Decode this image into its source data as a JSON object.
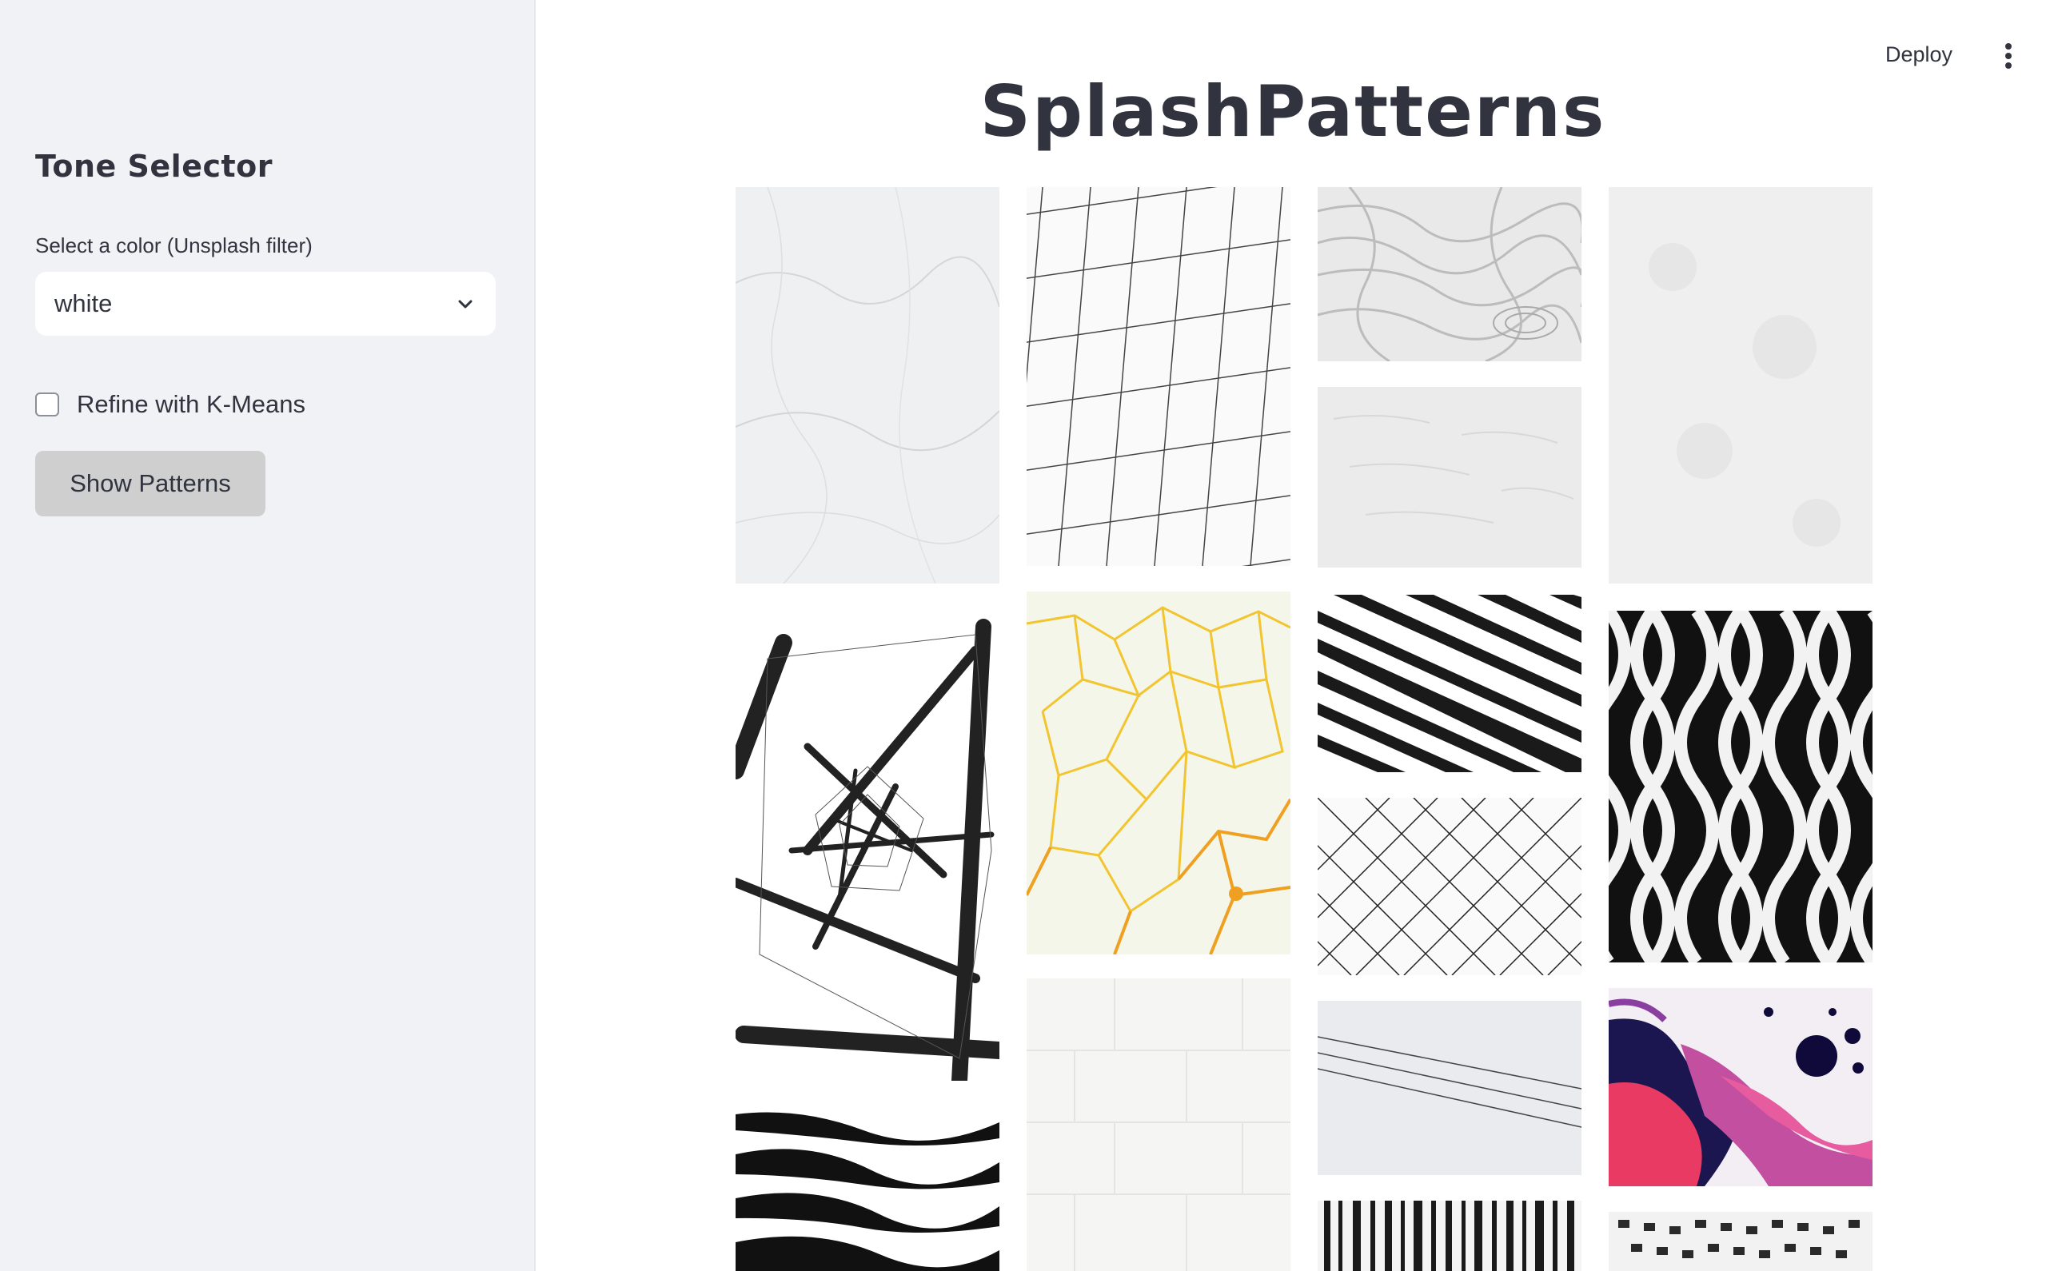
{
  "sidebar": {
    "title": "Tone Selector",
    "color_label": "Select a color (Unsplash filter)",
    "color_value": "white",
    "refine_label": "Refine with K-Means",
    "refine_checked": false,
    "button_label": "Show Patterns"
  },
  "header": {
    "deploy_label": "Deploy",
    "menu_icon": "more-vertical-icon"
  },
  "main": {
    "title": "SplashPatterns"
  },
  "gallery": {
    "columns": [
      [
        "white-marble",
        "black-poles-spiral",
        "black-white-waves"
      ],
      [
        "white-diamond-facade",
        "yellow-cell-veins",
        "white-brick-wall"
      ],
      [
        "white-swirl-sculpture",
        "white-plaster-texture",
        "diagonal-stripes",
        "chain-link-fence",
        "power-lines-sky",
        "vertical-poles"
      ],
      [
        "white-snow-texture",
        "black-white-lattice",
        "pink-purple-fluid-art",
        "white-grid-facade"
      ]
    ]
  },
  "colors": {
    "sidebar_bg": "#f0f2f6",
    "text": "#31333f",
    "button_bg": "#cfcfcf",
    "checkbox_border": "#8c8f99"
  }
}
